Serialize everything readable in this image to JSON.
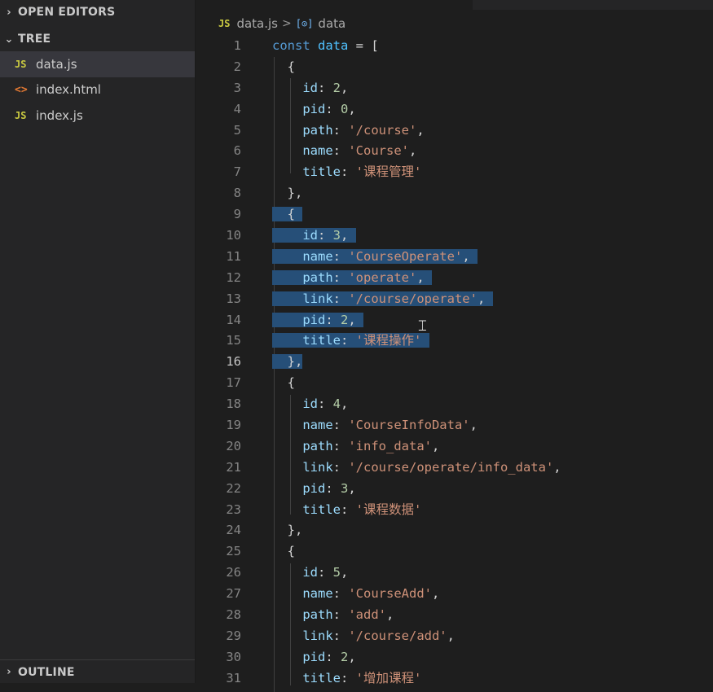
{
  "sidebar": {
    "open_editors_label": "OPEN EDITORS",
    "tree_label": "TREE",
    "outline_label": "OUTLINE",
    "files": [
      {
        "name": "data.js",
        "icon": "JS"
      },
      {
        "name": "index.html",
        "icon": "<>"
      },
      {
        "name": "index.js",
        "icon": "JS"
      }
    ]
  },
  "breadcrumb": {
    "file_icon": "JS",
    "file": "data.js",
    "separator": ">",
    "symbol_icon": "[⊙]",
    "symbol": "data"
  },
  "editor": {
    "current_line": 16,
    "line_numbers": [
      "1",
      "2",
      "3",
      "4",
      "5",
      "6",
      "7",
      "8",
      "9",
      "10",
      "11",
      "12",
      "13",
      "14",
      "15",
      "16",
      "17",
      "18",
      "19",
      "20",
      "21",
      "22",
      "23",
      "24",
      "25",
      "26",
      "27",
      "28",
      "29",
      "30",
      "31"
    ],
    "lines": [
      "const data = [",
      "  {",
      "    id: 2,",
      "    pid: 0,",
      "    path: '/course',",
      "    name: 'Course',",
      "    title: '课程管理'",
      "  },",
      "  {",
      "    id: 3,",
      "    name: 'CourseOperate',",
      "    path: 'operate',",
      "    link: '/course/operate',",
      "    pid: 2,",
      "    title: '课程操作'",
      "  },",
      "  {",
      "    id: 4,",
      "    name: 'CourseInfoData',",
      "    path: 'info_data',",
      "    link: '/course/operate/info_data',",
      "    pid: 3,",
      "    title: '课程数据'",
      "  },",
      "  {",
      "    id: 5,",
      "    name: 'CourseAdd',",
      "    path: 'add',",
      "    link: '/course/add',",
      "    pid: 2,",
      "    title: '增加课程'"
    ]
  },
  "colors": {
    "background": "#1e1e1e",
    "sidebar": "#252526",
    "selection": "#264f78",
    "keyword": "#569cd6",
    "property": "#9cdcfe",
    "number": "#b5cea8",
    "string": "#ce9178"
  }
}
